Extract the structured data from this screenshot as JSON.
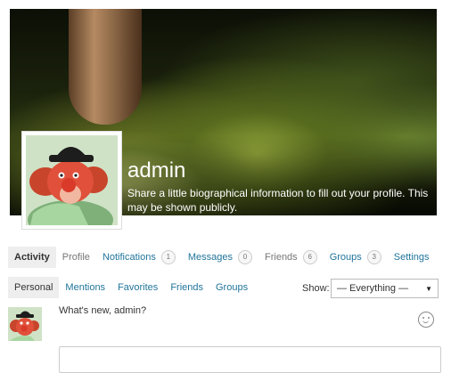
{
  "header": {
    "username": "admin",
    "bio": "Share a little biographical information to fill out your profile. This may be shown publicly."
  },
  "primary_nav": [
    {
      "label": "Activity",
      "active": true
    },
    {
      "label": "Profile"
    },
    {
      "label": "Notifications",
      "count": "1"
    },
    {
      "label": "Messages",
      "count": "0"
    },
    {
      "label": "Friends",
      "count": "6"
    },
    {
      "label": "Groups",
      "count": "3"
    },
    {
      "label": "Settings"
    }
  ],
  "secondary_nav": [
    {
      "label": "Personal",
      "active": true
    },
    {
      "label": "Mentions"
    },
    {
      "label": "Favorites"
    },
    {
      "label": "Friends"
    },
    {
      "label": "Groups"
    }
  ],
  "filter": {
    "label": "Show:",
    "selected": "— Everything —"
  },
  "post_form": {
    "prompt": "What's new, admin?"
  },
  "icons": {
    "emoji": "smiley-icon",
    "dropdown": "chevron-down-icon"
  },
  "colors": {
    "link": "#21759b",
    "active_tab_bg": "#eeeeee"
  }
}
